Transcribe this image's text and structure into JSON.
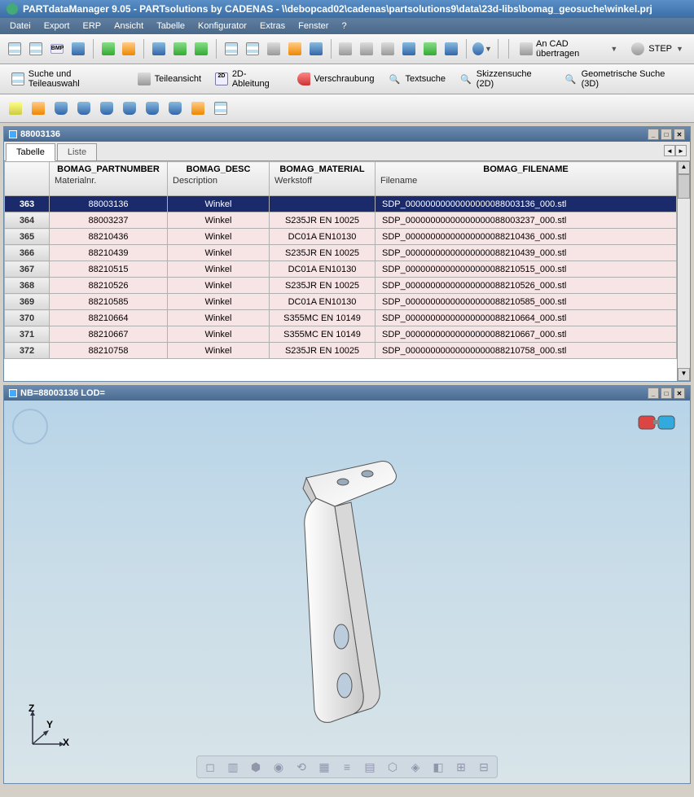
{
  "title": "PARTdataManager 9.05 - PARTsolutions by CADENAS - \\\\debopcad02\\cadenas\\partsolutions9\\data\\23d-libs\\bomag_geosuche\\winkel.prj",
  "menu": [
    "Datei",
    "Export",
    "ERP",
    "Ansicht",
    "Tabelle",
    "Konfigurator",
    "Extras",
    "Fenster",
    "?"
  ],
  "toolbar2": {
    "search": "Suche und Teileauswahl",
    "partview": "Teileansicht",
    "deriv2d": "2D-Ableitung",
    "screw": "Verschraubung",
    "textsearch": "Textsuche",
    "sketch2d": "Skizzensuche (2D)",
    "geo3d": "Geometrische Suche (3D)"
  },
  "cad": {
    "transfer": "An CAD übertragen",
    "format": "STEP"
  },
  "panel1": {
    "title": "88003136",
    "tabs": [
      "Tabelle",
      "Liste"
    ]
  },
  "panel2": {
    "title": "NB=88003136 LOD="
  },
  "columns": [
    {
      "id": "BOMAG_PARTNUMBER",
      "sub": "Materialnr."
    },
    {
      "id": "BOMAG_DESC",
      "sub": "Description"
    },
    {
      "id": "BOMAG_MATERIAL",
      "sub": "Werkstoff"
    },
    {
      "id": "BOMAG_FILENAME",
      "sub": "Filename"
    }
  ],
  "rows": [
    {
      "n": "363",
      "pn": "88003136",
      "desc": "Winkel",
      "mat": "",
      "fn": "SDP_00000000000000000088003136_000.stl",
      "sel": true
    },
    {
      "n": "364",
      "pn": "88003237",
      "desc": "Winkel",
      "mat": "S235JR EN 10025",
      "fn": "SDP_00000000000000000088003237_000.stl"
    },
    {
      "n": "365",
      "pn": "88210436",
      "desc": "Winkel",
      "mat": "DC01A EN10130",
      "fn": "SDP_00000000000000000088210436_000.stl"
    },
    {
      "n": "366",
      "pn": "88210439",
      "desc": "Winkel",
      "mat": "S235JR EN 10025",
      "fn": "SDP_00000000000000000088210439_000.stl"
    },
    {
      "n": "367",
      "pn": "88210515",
      "desc": "Winkel",
      "mat": "DC01A EN10130",
      "fn": "SDP_00000000000000000088210515_000.stl"
    },
    {
      "n": "368",
      "pn": "88210526",
      "desc": "Winkel",
      "mat": "S235JR EN 10025",
      "fn": "SDP_00000000000000000088210526_000.stl"
    },
    {
      "n": "369",
      "pn": "88210585",
      "desc": "Winkel",
      "mat": "DC01A EN10130",
      "fn": "SDP_00000000000000000088210585_000.stl"
    },
    {
      "n": "370",
      "pn": "88210664",
      "desc": "Winkel",
      "mat": "S355MC EN 10149",
      "fn": "SDP_00000000000000000088210664_000.stl"
    },
    {
      "n": "371",
      "pn": "88210667",
      "desc": "Winkel",
      "mat": "S355MC EN 10149",
      "fn": "SDP_00000000000000000088210667_000.stl"
    },
    {
      "n": "372",
      "pn": "88210758",
      "desc": "Winkel",
      "mat": "S235JR EN 10025",
      "fn": "SDP_00000000000000000088210758_000.stl"
    }
  ],
  "axis": {
    "x": "X",
    "y": "Y",
    "z": "Z"
  },
  "bmp": "BMP"
}
